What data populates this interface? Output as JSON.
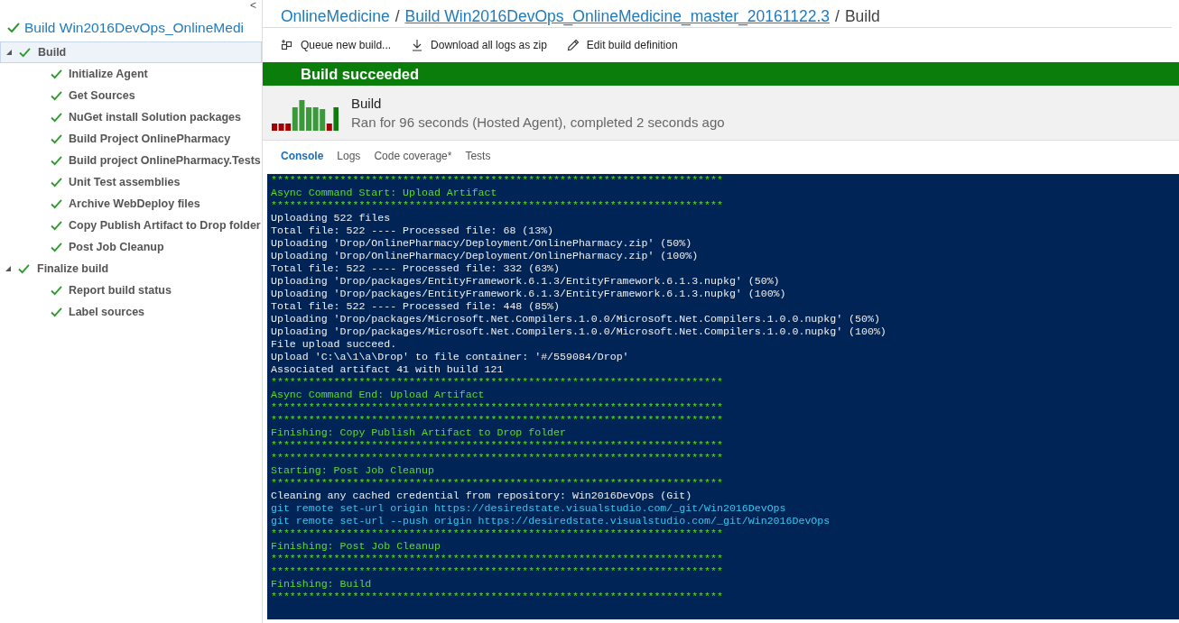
{
  "sidebar": {
    "collapse_glyph": "<",
    "title": "Build Win2016DevOps_OnlineMedi",
    "tree": [
      {
        "label": "Build",
        "selected": true,
        "expanded": true,
        "children": [
          {
            "label": "Initialize Agent",
            "selected": false
          },
          {
            "label": "Get Sources",
            "selected": false
          },
          {
            "label": "NuGet install Solution packages",
            "selected": false
          },
          {
            "label": "Build Project OnlinePharmacy",
            "selected": false
          },
          {
            "label": "Build project OnlinePharmacy.Tests",
            "selected": false
          },
          {
            "label": "Unit Test assemblies",
            "selected": false
          },
          {
            "label": "Archive WebDeploy files",
            "selected": false
          },
          {
            "label": "Copy Publish Artifact to Drop folder",
            "selected": false
          },
          {
            "label": "Post Job Cleanup",
            "selected": false
          }
        ]
      },
      {
        "label": "Finalize build",
        "selected": false,
        "expanded": true,
        "children": [
          {
            "label": "Report build status",
            "selected": false
          },
          {
            "label": "Label sources",
            "selected": false
          }
        ]
      }
    ]
  },
  "breadcrumb": {
    "project": "OnlineMedicine",
    "separator_1": "/",
    "build": "Build Win2016DevOps_OnlineMedicine_master_20161122.3",
    "separator_2": "/",
    "page": "Build"
  },
  "toolbar": [
    {
      "kind": "queue",
      "label": "Queue new build..."
    },
    {
      "kind": "download",
      "label": "Download all logs as zip"
    },
    {
      "kind": "edit",
      "label": "Edit build definition"
    }
  ],
  "banner": "Build succeeded",
  "summary": {
    "name": "Build",
    "details": "Ran for 96 seconds (Hosted Agent), completed 2 seconds ago"
  },
  "tabs": [
    {
      "label": "Console",
      "selected": true
    },
    {
      "label": "Logs",
      "selected": false
    },
    {
      "label": "Code coverage*",
      "selected": false
    },
    {
      "label": "Tests",
      "selected": false
    }
  ],
  "console": [
    {
      "kind": "rule",
      "text": "************************************************************************"
    },
    {
      "kind": "header",
      "text": "Async Command Start: Upload Artifact"
    },
    {
      "kind": "rule",
      "text": "************************************************************************"
    },
    {
      "kind": "text",
      "text": "Uploading 522 files"
    },
    {
      "kind": "text",
      "text": "Total file: 522 ---- Processed file: 68 (13%)"
    },
    {
      "kind": "text",
      "text": "Uploading 'Drop/OnlinePharmacy/Deployment/OnlinePharmacy.zip' (50%)"
    },
    {
      "kind": "text",
      "text": "Uploading 'Drop/OnlinePharmacy/Deployment/OnlinePharmacy.zip' (100%)"
    },
    {
      "kind": "text",
      "text": "Total file: 522 ---- Processed file: 332 (63%)"
    },
    {
      "kind": "text",
      "text": "Uploading 'Drop/packages/EntityFramework.6.1.3/EntityFramework.6.1.3.nupkg' (50%)"
    },
    {
      "kind": "text",
      "text": "Uploading 'Drop/packages/EntityFramework.6.1.3/EntityFramework.6.1.3.nupkg' (100%)"
    },
    {
      "kind": "text",
      "text": "Total file: 522 ---- Processed file: 448 (85%)"
    },
    {
      "kind": "text",
      "text": "Uploading 'Drop/packages/Microsoft.Net.Compilers.1.0.0/Microsoft.Net.Compilers.1.0.0.nupkg' (50%)"
    },
    {
      "kind": "text",
      "text": "Uploading 'Drop/packages/Microsoft.Net.Compilers.1.0.0/Microsoft.Net.Compilers.1.0.0.nupkg' (100%)"
    },
    {
      "kind": "text",
      "text": "File upload succeed."
    },
    {
      "kind": "text",
      "text": "Upload 'C:\\a\\1\\a\\Drop' to file container: '#/559084/Drop'"
    },
    {
      "kind": "text",
      "text": "Associated artifact 41 with build 121"
    },
    {
      "kind": "rule",
      "text": "************************************************************************"
    },
    {
      "kind": "header",
      "text": "Async Command End: Upload Artifact"
    },
    {
      "kind": "rule",
      "text": "************************************************************************"
    },
    {
      "kind": "rule",
      "text": "************************************************************************"
    },
    {
      "kind": "header",
      "text": "Finishing: Copy Publish Artifact to Drop folder"
    },
    {
      "kind": "rule",
      "text": "************************************************************************"
    },
    {
      "kind": "rule",
      "text": "************************************************************************"
    },
    {
      "kind": "header",
      "text": "Starting: Post Job Cleanup"
    },
    {
      "kind": "rule",
      "text": "************************************************************************"
    },
    {
      "kind": "text",
      "text": "Cleaning any cached credential from repository: Win2016DevOps (Git)"
    },
    {
      "kind": "command",
      "text": "git remote set-url origin https://desiredstate.visualstudio.com/_git/Win2016DevOps"
    },
    {
      "kind": "command",
      "text": "git remote set-url --push origin https://desiredstate.visualstudio.com/_git/Win2016DevOps"
    },
    {
      "kind": "rule",
      "text": "************************************************************************"
    },
    {
      "kind": "header",
      "text": "Finishing: Post Job Cleanup"
    },
    {
      "kind": "rule",
      "text": "************************************************************************"
    },
    {
      "kind": "rule",
      "text": "************************************************************************"
    },
    {
      "kind": "header",
      "text": "Finishing: Build"
    },
    {
      "kind": "rule",
      "text": "************************************************************************"
    }
  ]
}
